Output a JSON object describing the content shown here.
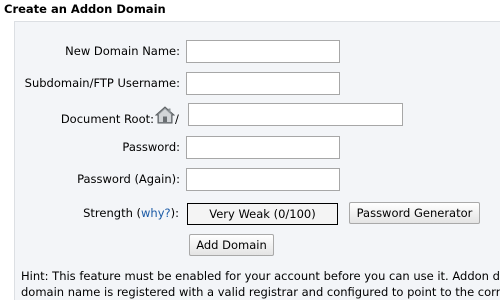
{
  "page": {
    "heading": "Create an Addon Domain"
  },
  "form": {
    "new_domain_label": "New Domain Name:",
    "new_domain_value": "",
    "subdomain_label": "Subdomain/FTP Username:",
    "subdomain_value": "",
    "docroot_label": "Document Root:",
    "docroot_icon": "home-icon",
    "docroot_prefix": "/",
    "docroot_value": "",
    "password_label": "Password:",
    "password_value": "",
    "password_again_label": "Password (Again):",
    "password_again_value": "",
    "strength_label": "Strength (",
    "strength_link": "why?",
    "strength_label_end": "):",
    "strength_value": "Very Weak (0/100)",
    "password_generator_button": "Password Generator",
    "add_domain_button": "Add Domain"
  },
  "hint": {
    "line1": "Hint: This feature must be enabled for your account before you can use it. Addon do",
    "line2": "domain name is registered with a valid registrar and configured to point to the corre"
  },
  "colors": {
    "panel_background": "#f3f5f8",
    "link": "#1a5aa6",
    "strength_border": "#000000"
  }
}
